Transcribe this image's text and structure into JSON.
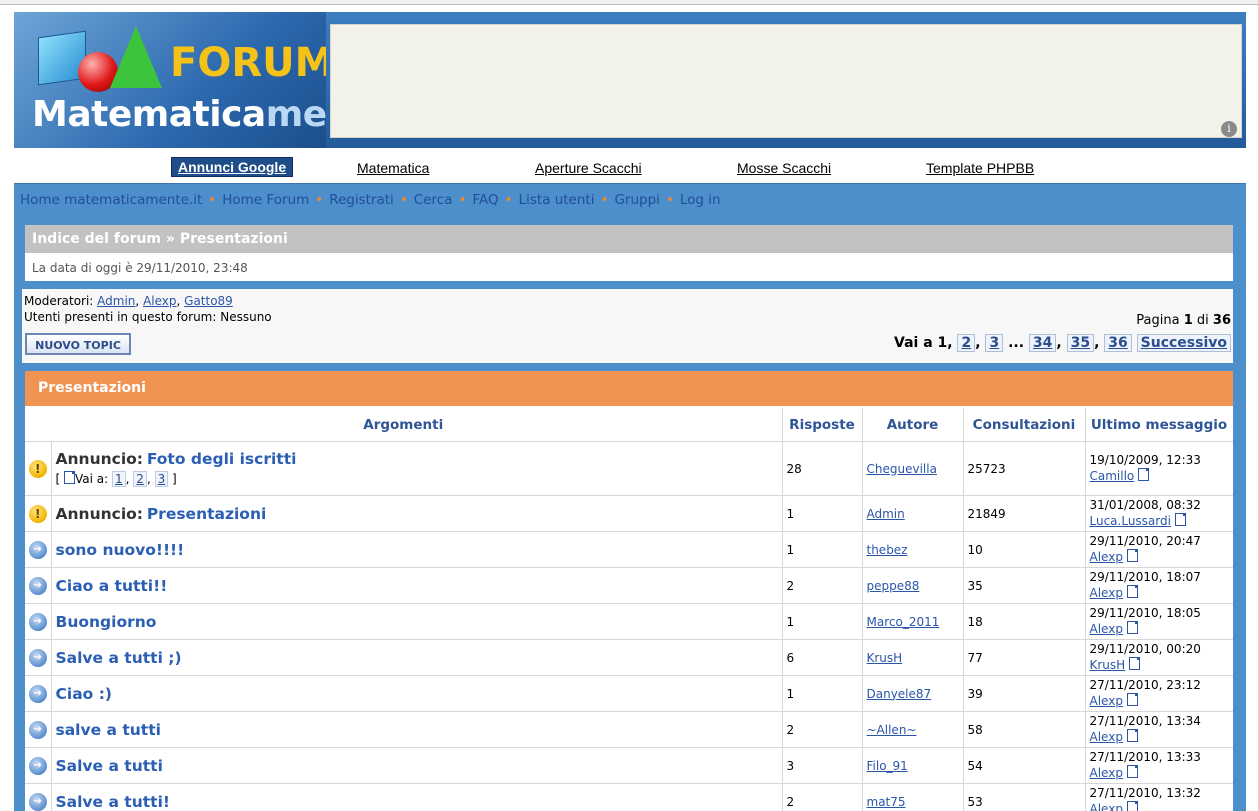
{
  "banner": {
    "logo_top": "FORUM",
    "logo_bottom_main": "Matematica",
    "logo_bottom_accent": "mente",
    "ad_info_icon": "i"
  },
  "link_unit": {
    "label": "Annunci Google",
    "links": [
      "Matematica",
      "Aperture Scacchi",
      "Mosse Scacchi",
      "Template PHPBB"
    ]
  },
  "nav": {
    "links": [
      "Home matematicamente.it",
      "Home Forum",
      "Registrati",
      "Cerca",
      "FAQ",
      "Lista utenti",
      "Gruppi",
      "Log in"
    ],
    "separator": "•"
  },
  "breadcrumb": {
    "root": "Indice del forum",
    "sep": "»",
    "current": "Presentazioni",
    "date_text": "La data di oggi è 29/11/2010, 23:48"
  },
  "forum_info": {
    "moderators_label": "Moderatori:",
    "moderators": [
      "Admin",
      "Alexp",
      "Gatto89"
    ],
    "online_text": "Utenti presenti in questo forum: Nessuno",
    "new_topic_button": "NUOVO TOPIC"
  },
  "pagination": {
    "page_label": "Pagina",
    "current": "1",
    "of_label": "di",
    "total": "36",
    "goto_label": "Vai a",
    "current_page": "1",
    "pages": [
      "2",
      "3",
      "34",
      "35",
      "36"
    ],
    "ellipsis": "...",
    "next_label": "Successivo"
  },
  "topics": {
    "section_title": "Presentazioni",
    "columns": [
      "Argomenti",
      "Risposte",
      "Autore",
      "Consultazioni",
      "Ultimo messaggio"
    ],
    "rows": [
      {
        "type": "announce",
        "prefix": "Annuncio:",
        "title": "Foto degli iscritti",
        "goto": [
          "1",
          "2",
          "3"
        ],
        "goto_label": "Vai a:",
        "replies": "28",
        "author": "Cheguevilla",
        "views": "25723",
        "last_date": "19/10/2009, 12:33",
        "last_user": "Camillo",
        "icon": "announcement-icon"
      },
      {
        "type": "announce",
        "prefix": "Annuncio:",
        "title": "Presentazioni",
        "replies": "1",
        "author": "Admin",
        "views": "21849",
        "last_date": "31/01/2008, 08:32",
        "last_user": "Luca.Lussardi",
        "icon": "announcement-icon"
      },
      {
        "type": "topic",
        "title": "sono nuovo!!!!",
        "replies": "1",
        "author": "thebez",
        "views": "10",
        "last_date": "29/11/2010, 20:47",
        "last_user": "Alexp",
        "icon": "topic-icon"
      },
      {
        "type": "topic",
        "title": "Ciao a tutti!!",
        "replies": "2",
        "author": "peppe88",
        "views": "35",
        "last_date": "29/11/2010, 18:07",
        "last_user": "Alexp",
        "icon": "topic-icon"
      },
      {
        "type": "topic",
        "title": "Buongiorno",
        "replies": "1",
        "author": "Marco_2011",
        "views": "18",
        "last_date": "29/11/2010, 18:05",
        "last_user": "Alexp",
        "icon": "topic-icon"
      },
      {
        "type": "topic",
        "title": "Salve a tutti ;)",
        "replies": "6",
        "author": "KrusH",
        "views": "77",
        "last_date": "29/11/2010, 00:20",
        "last_user": "KrusH",
        "icon": "topic-icon"
      },
      {
        "type": "topic",
        "title": "Ciao :)",
        "replies": "1",
        "author": "Danyele87",
        "views": "39",
        "last_date": "27/11/2010, 23:12",
        "last_user": "Alexp",
        "icon": "topic-icon"
      },
      {
        "type": "topic",
        "title": "salve a tutti",
        "replies": "2",
        "author": "~Allen~",
        "views": "58",
        "last_date": "27/11/2010, 13:34",
        "last_user": "Alexp",
        "icon": "topic-icon"
      },
      {
        "type": "topic",
        "title": "Salve a tutti",
        "replies": "3",
        "author": "Filo_91",
        "views": "54",
        "last_date": "27/11/2010, 13:33",
        "last_user": "Alexp",
        "icon": "topic-icon"
      },
      {
        "type": "topic",
        "title": "Salve a tutti!",
        "replies": "2",
        "author": "mat75",
        "views": "53",
        "last_date": "27/11/2010, 13:32",
        "last_user": "Alexp",
        "icon": "topic-icon"
      }
    ]
  },
  "colors": {
    "nav_blue": "#4c8fcb",
    "section_orange": "#f19452",
    "link_blue": "#2a5fb4"
  }
}
